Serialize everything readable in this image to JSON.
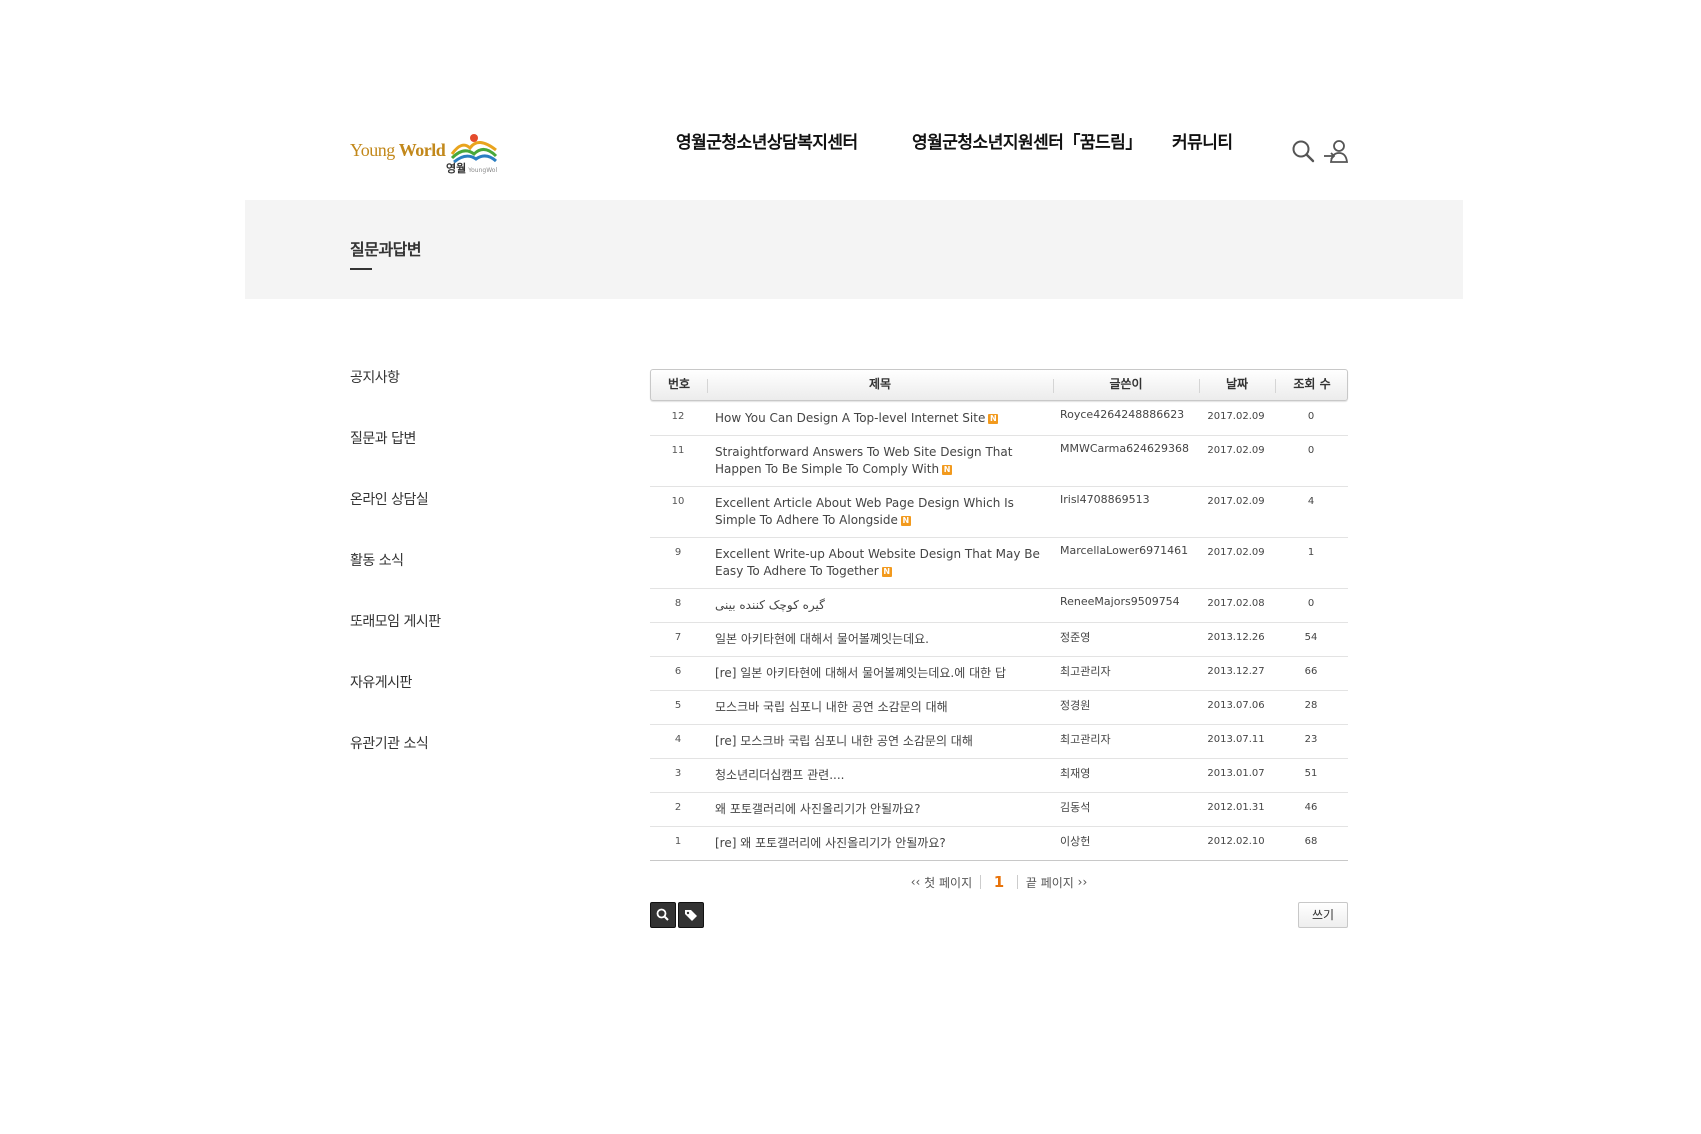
{
  "header": {
    "logo_text_light": "Young",
    "logo_text_bold": "World",
    "logo_sub": "영월",
    "logo_sub_small": "YoungWol",
    "nav": [
      "영월군청소년상담복지센터",
      "영월군청소년지원센터「꿈드림」",
      "커뮤니티"
    ],
    "icons": [
      "search-icon",
      "login-icon"
    ]
  },
  "page": {
    "title": "질문과답변"
  },
  "sidebar": {
    "items": [
      "공지사항",
      "질문과 답변",
      "온라인 상담실",
      "활동 소식",
      "또래모임 게시판",
      "자유게시판",
      "유관기관 소식"
    ]
  },
  "board": {
    "columns": [
      "번호",
      "제목",
      "글쓴이",
      "날짜",
      "조회 수"
    ],
    "new_badge": "N",
    "rows": [
      {
        "no": "12",
        "title": "How You Can Design A Top-level Internet Site",
        "new": true,
        "author": "Royce4264248886623",
        "date": "2017.02.09",
        "hits": "0"
      },
      {
        "no": "11",
        "title": "Straightforward Answers To Web Site Design That Happen To Be Simple To Comply With",
        "new": true,
        "author": "MMWCarma624629368",
        "date": "2017.02.09",
        "hits": "0"
      },
      {
        "no": "10",
        "title": "Excellent Article About Web Page Design Which Is Simple To Adhere To Alongside",
        "new": true,
        "author": "Irisl4708869513",
        "date": "2017.02.09",
        "hits": "4"
      },
      {
        "no": "9",
        "title": "Excellent Write-up About Website Design That May Be Easy To Adhere To Together",
        "new": true,
        "author": "MarcellaLower6971461",
        "date": "2017.02.09",
        "hits": "1"
      },
      {
        "no": "8",
        "title": "گیره کوچک کننده بینی",
        "new": false,
        "rtl": true,
        "author": "ReneeMajors9509754",
        "date": "2017.02.08",
        "hits": "0"
      },
      {
        "no": "7",
        "title": "일본 아키타현에 대해서 물어볼꼐잇는데요.",
        "new": false,
        "author": "정준영",
        "date": "2013.12.26",
        "hits": "54"
      },
      {
        "no": "6",
        "title": "[re] 일본 아키타현에 대해서 물어볼꼐잇는데요.에 대한 답",
        "new": false,
        "author": "최고관리자",
        "date": "2013.12.27",
        "hits": "66"
      },
      {
        "no": "5",
        "title": "모스크바 국립 심포니 내한 공연 소감문의 대해",
        "new": false,
        "author": "정경원",
        "date": "2013.07.06",
        "hits": "28"
      },
      {
        "no": "4",
        "title": "[re] 모스크바 국립 심포니 내한 공연 소감문의 대해",
        "new": false,
        "author": "최고관리자",
        "date": "2013.07.11",
        "hits": "23"
      },
      {
        "no": "3",
        "title": "청소년리더십캠프 관련....",
        "new": false,
        "author": "최재영",
        "date": "2013.01.07",
        "hits": "51"
      },
      {
        "no": "2",
        "title": "왜 포토갤러리에 사진올리기가 안될까요?",
        "new": false,
        "author": "김동석",
        "date": "2012.01.31",
        "hits": "46"
      },
      {
        "no": "1",
        "title": "[re] 왜 포토갤러리에 사진올리기가 안될까요?",
        "new": false,
        "author": "이상헌",
        "date": "2012.02.10",
        "hits": "68"
      }
    ]
  },
  "pagination": {
    "first": "첫 페이지",
    "current": "1",
    "last": "끝 페이지"
  },
  "actions": {
    "write_label": "쓰기"
  },
  "colors": {
    "accent": "#e8730a",
    "badge": "#f29a1e",
    "logo": "#c2881b",
    "band": "#f4f4f4"
  }
}
